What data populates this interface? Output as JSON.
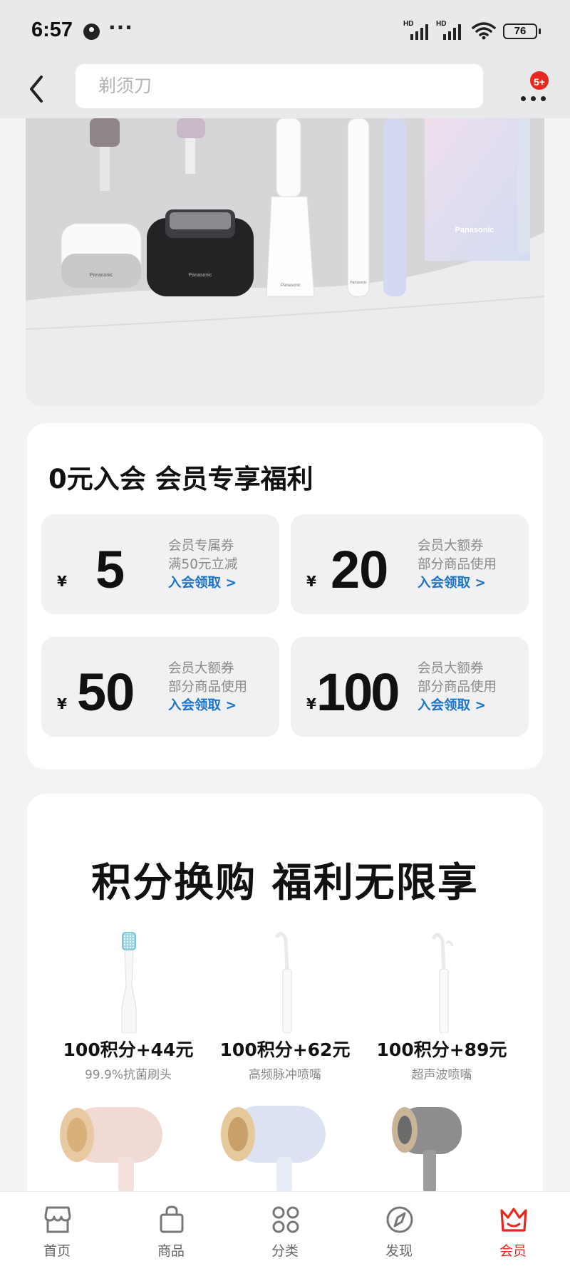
{
  "status_bar": {
    "time": "6:57",
    "more": "···",
    "sim1": "HD",
    "sim2": "HD",
    "battery": "76"
  },
  "header": {
    "search_placeholder": "剃须刀",
    "notification_badge": "5+"
  },
  "banner": {
    "brand_labels": [
      "Panasonic",
      "Panasonic",
      "Panasonic",
      "Panasonic",
      "Panasonic"
    ]
  },
  "member": {
    "title": "0元入会 会员专享福利",
    "currency": "¥",
    "coupons": [
      {
        "amount": "5",
        "line1": "会员专属券",
        "line2": "满50元立减",
        "claim": "入会领取 >"
      },
      {
        "amount": "20",
        "line1": "会员大额券",
        "line2": "部分商品使用",
        "claim": "入会领取 >"
      },
      {
        "amount": "50",
        "line1": "会员大额券",
        "line2": "部分商品使用",
        "claim": "入会领取 >"
      },
      {
        "amount": "100",
        "line1": "会员大额券",
        "line2": "部分商品使用",
        "claim": "入会领取 >"
      }
    ]
  },
  "points": {
    "title": "积分换购 福利无限享",
    "products": [
      {
        "price": "100积分+44元",
        "desc": "99.9%抗菌刷头",
        "icon": "toothbrush-head"
      },
      {
        "price": "100积分+62元",
        "desc": "高频脉冲喷嘴",
        "icon": "irrigator-nozzle"
      },
      {
        "price": "100积分+89元",
        "desc": "超声波喷嘴",
        "icon": "irrigator-nozzles"
      }
    ],
    "dryers": [
      {
        "color": "#f1d9d4",
        "icon": "hair-dryer"
      },
      {
        "color": "#dbe3f2",
        "icon": "hair-dryer"
      },
      {
        "color": "#8d8d90",
        "icon": "hair-dryer"
      }
    ]
  },
  "bottom_nav": {
    "active_color": "#e8281e",
    "items": [
      {
        "label": "首页",
        "icon": "home-icon"
      },
      {
        "label": "商品",
        "icon": "bag-icon"
      },
      {
        "label": "分类",
        "icon": "grid-icon"
      },
      {
        "label": "发现",
        "icon": "compass-icon"
      },
      {
        "label": "会员",
        "icon": "crown-icon"
      }
    ]
  }
}
